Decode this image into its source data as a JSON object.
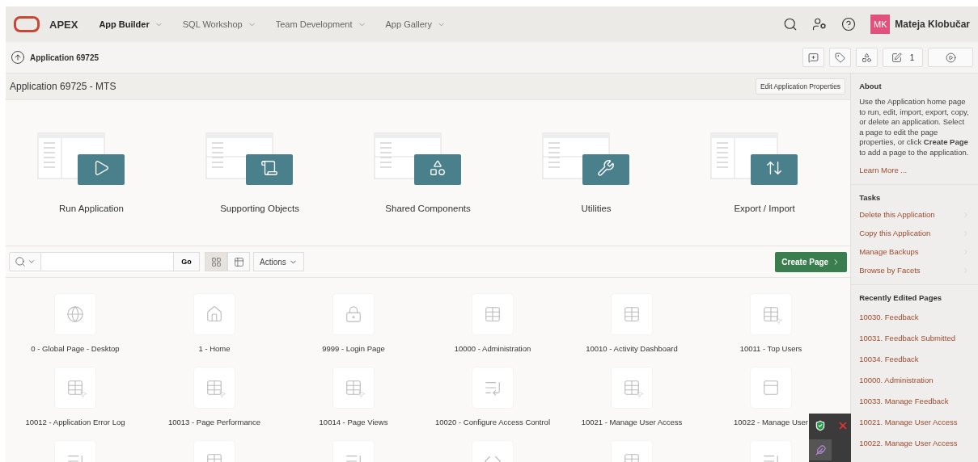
{
  "header": {
    "brand": "APEX",
    "nav": [
      {
        "label": "App Builder",
        "selected": true
      },
      {
        "label": "SQL Workshop",
        "selected": false
      },
      {
        "label": "Team Development",
        "selected": false
      },
      {
        "label": "App Gallery",
        "selected": false
      }
    ],
    "user": {
      "initials": "MK",
      "name": "Mateja Klobučar"
    }
  },
  "breadcrumb": {
    "label": "Application 69725",
    "tools": [
      {
        "kind": "comment"
      },
      {
        "kind": "tag"
      },
      {
        "kind": "shapes"
      },
      {
        "kind": "edit",
        "count": "1"
      },
      {
        "kind": "run"
      }
    ]
  },
  "title_bar": {
    "title": "Application 69725 - MTS",
    "button": "Edit Application Properties"
  },
  "hero": [
    {
      "kind": "run",
      "label": "Run Application"
    },
    {
      "kind": "objects",
      "label": "Supporting Objects"
    },
    {
      "kind": "shared",
      "label": "Shared Components"
    },
    {
      "kind": "utilities",
      "label": "Utilities"
    },
    {
      "kind": "export",
      "label": "Export / Import"
    }
  ],
  "search_bar": {
    "go": "Go",
    "views": [
      {
        "kind": "icons",
        "selected": true
      },
      {
        "kind": "report",
        "selected": false
      }
    ],
    "actions": "Actions",
    "create": "Create Page"
  },
  "pages": [
    {
      "kind": "globe",
      "label": "0 - Global Page - Desktop"
    },
    {
      "kind": "home",
      "label": "1 - Home"
    },
    {
      "kind": "lock",
      "label": "9999 - Login Page"
    },
    {
      "kind": "table",
      "label": "10000 - Administration"
    },
    {
      "kind": "table",
      "label": "10010 - Activity Dashboard"
    },
    {
      "kind": "table-pointer",
      "label": "10011 - Top Users"
    },
    {
      "kind": "table-pointer",
      "label": "10012 - Application Error Log"
    },
    {
      "kind": "table-pointer",
      "label": "10013 - Page Performance"
    },
    {
      "kind": "table-pointer",
      "label": "10014 - Page Views"
    },
    {
      "kind": "list",
      "label": "10020 - Configure Access Control"
    },
    {
      "kind": "table-pointer",
      "label": "10021 - Manage User Access"
    },
    {
      "kind": "form",
      "label": "10022 - Manage User"
    },
    {
      "kind": "list"
    },
    {
      "kind": "table"
    },
    {
      "kind": "list"
    },
    {
      "kind": "code"
    },
    {
      "kind": "table"
    },
    {
      "kind": "list"
    }
  ],
  "sidebar": {
    "about_title": "About",
    "about_text": "Use the Application home page to run, edit, import, export, copy, or delete an application. Select a page to edit the page properties, or click **Create Page** to add a page to the application.",
    "learn_more": "Learn More ...",
    "tasks_title": "Tasks",
    "tasks": [
      "Delete this Application",
      "Copy this Application",
      "Manage Backups",
      "Browse by Facets"
    ],
    "recent_title": "Recently Edited Pages",
    "recent": [
      "10030. Feedback",
      "10031. Feedback Submitted",
      "10034. Feedback",
      "10000. Administration",
      "10033. Manage Feedback",
      "10021. Manage User Access",
      "10022. Manage User Access"
    ]
  }
}
